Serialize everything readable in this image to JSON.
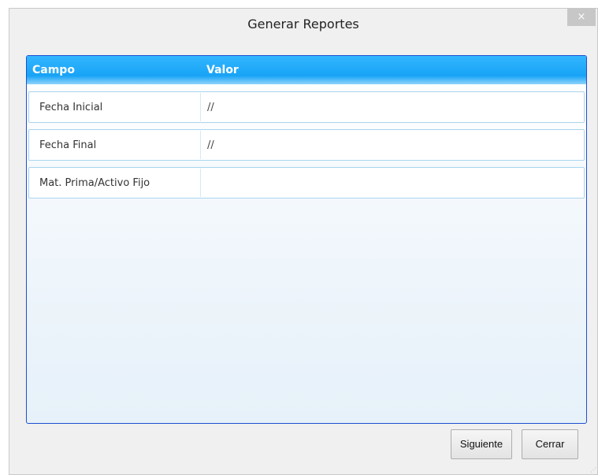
{
  "window": {
    "title": "Generar Reportes",
    "close_label": "×"
  },
  "grid": {
    "columns": [
      "Campo",
      "Valor"
    ],
    "rows": [
      {
        "campo": "Fecha Inicial",
        "valor": "//"
      },
      {
        "campo": "Fecha Final",
        "valor": "//"
      },
      {
        "campo": "Mat. Prima/Activo Fijo",
        "valor": ""
      }
    ]
  },
  "buttons": {
    "next": "Siguiente",
    "close": "Cerrar"
  },
  "colors": {
    "header_blue": "#1aa6f7",
    "grid_border": "#1f4fd1"
  }
}
